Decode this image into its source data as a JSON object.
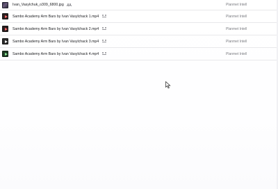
{
  "files": [
    {
      "name": "Ivan_Vasylchuk_o309_6800.jpg",
      "type": "image",
      "shared": true,
      "owner": "Planmet Intell",
      "thumb_icon": "image-thumbnail"
    },
    {
      "name": "Sambo Academy Arm Bars by Ivan Vasylchack 1.mp4",
      "type": "video",
      "shared": true,
      "owner": "Planmet Intell",
      "thumb_icon": "video-play-icon",
      "accent": "#ff6b6b"
    },
    {
      "name": "Sambo Academy Arm Bars by Ivan Vasylchack 2.mp4",
      "type": "video",
      "shared": true,
      "owner": "Planmet Intell",
      "thumb_icon": "video-play-icon",
      "accent": "#ff6b6b"
    },
    {
      "name": "Sambo Academy Arm Bars by Ivan Vasylchack 3.mp4",
      "type": "video",
      "shared": true,
      "owner": "Planmet Intell",
      "thumb_icon": "video-play-icon",
      "accent": "#ffffff"
    },
    {
      "name": "Sambo Academy Arm Bars by Ivan Vasylchack 4.mp4",
      "type": "video",
      "shared": true,
      "owner": "Planmet Intell",
      "thumb_icon": "video-play-icon",
      "accent": "#8ef09a"
    }
  ],
  "shared_icon": "people-shared-icon",
  "cursor_icon": "mouse-pointer-icon"
}
